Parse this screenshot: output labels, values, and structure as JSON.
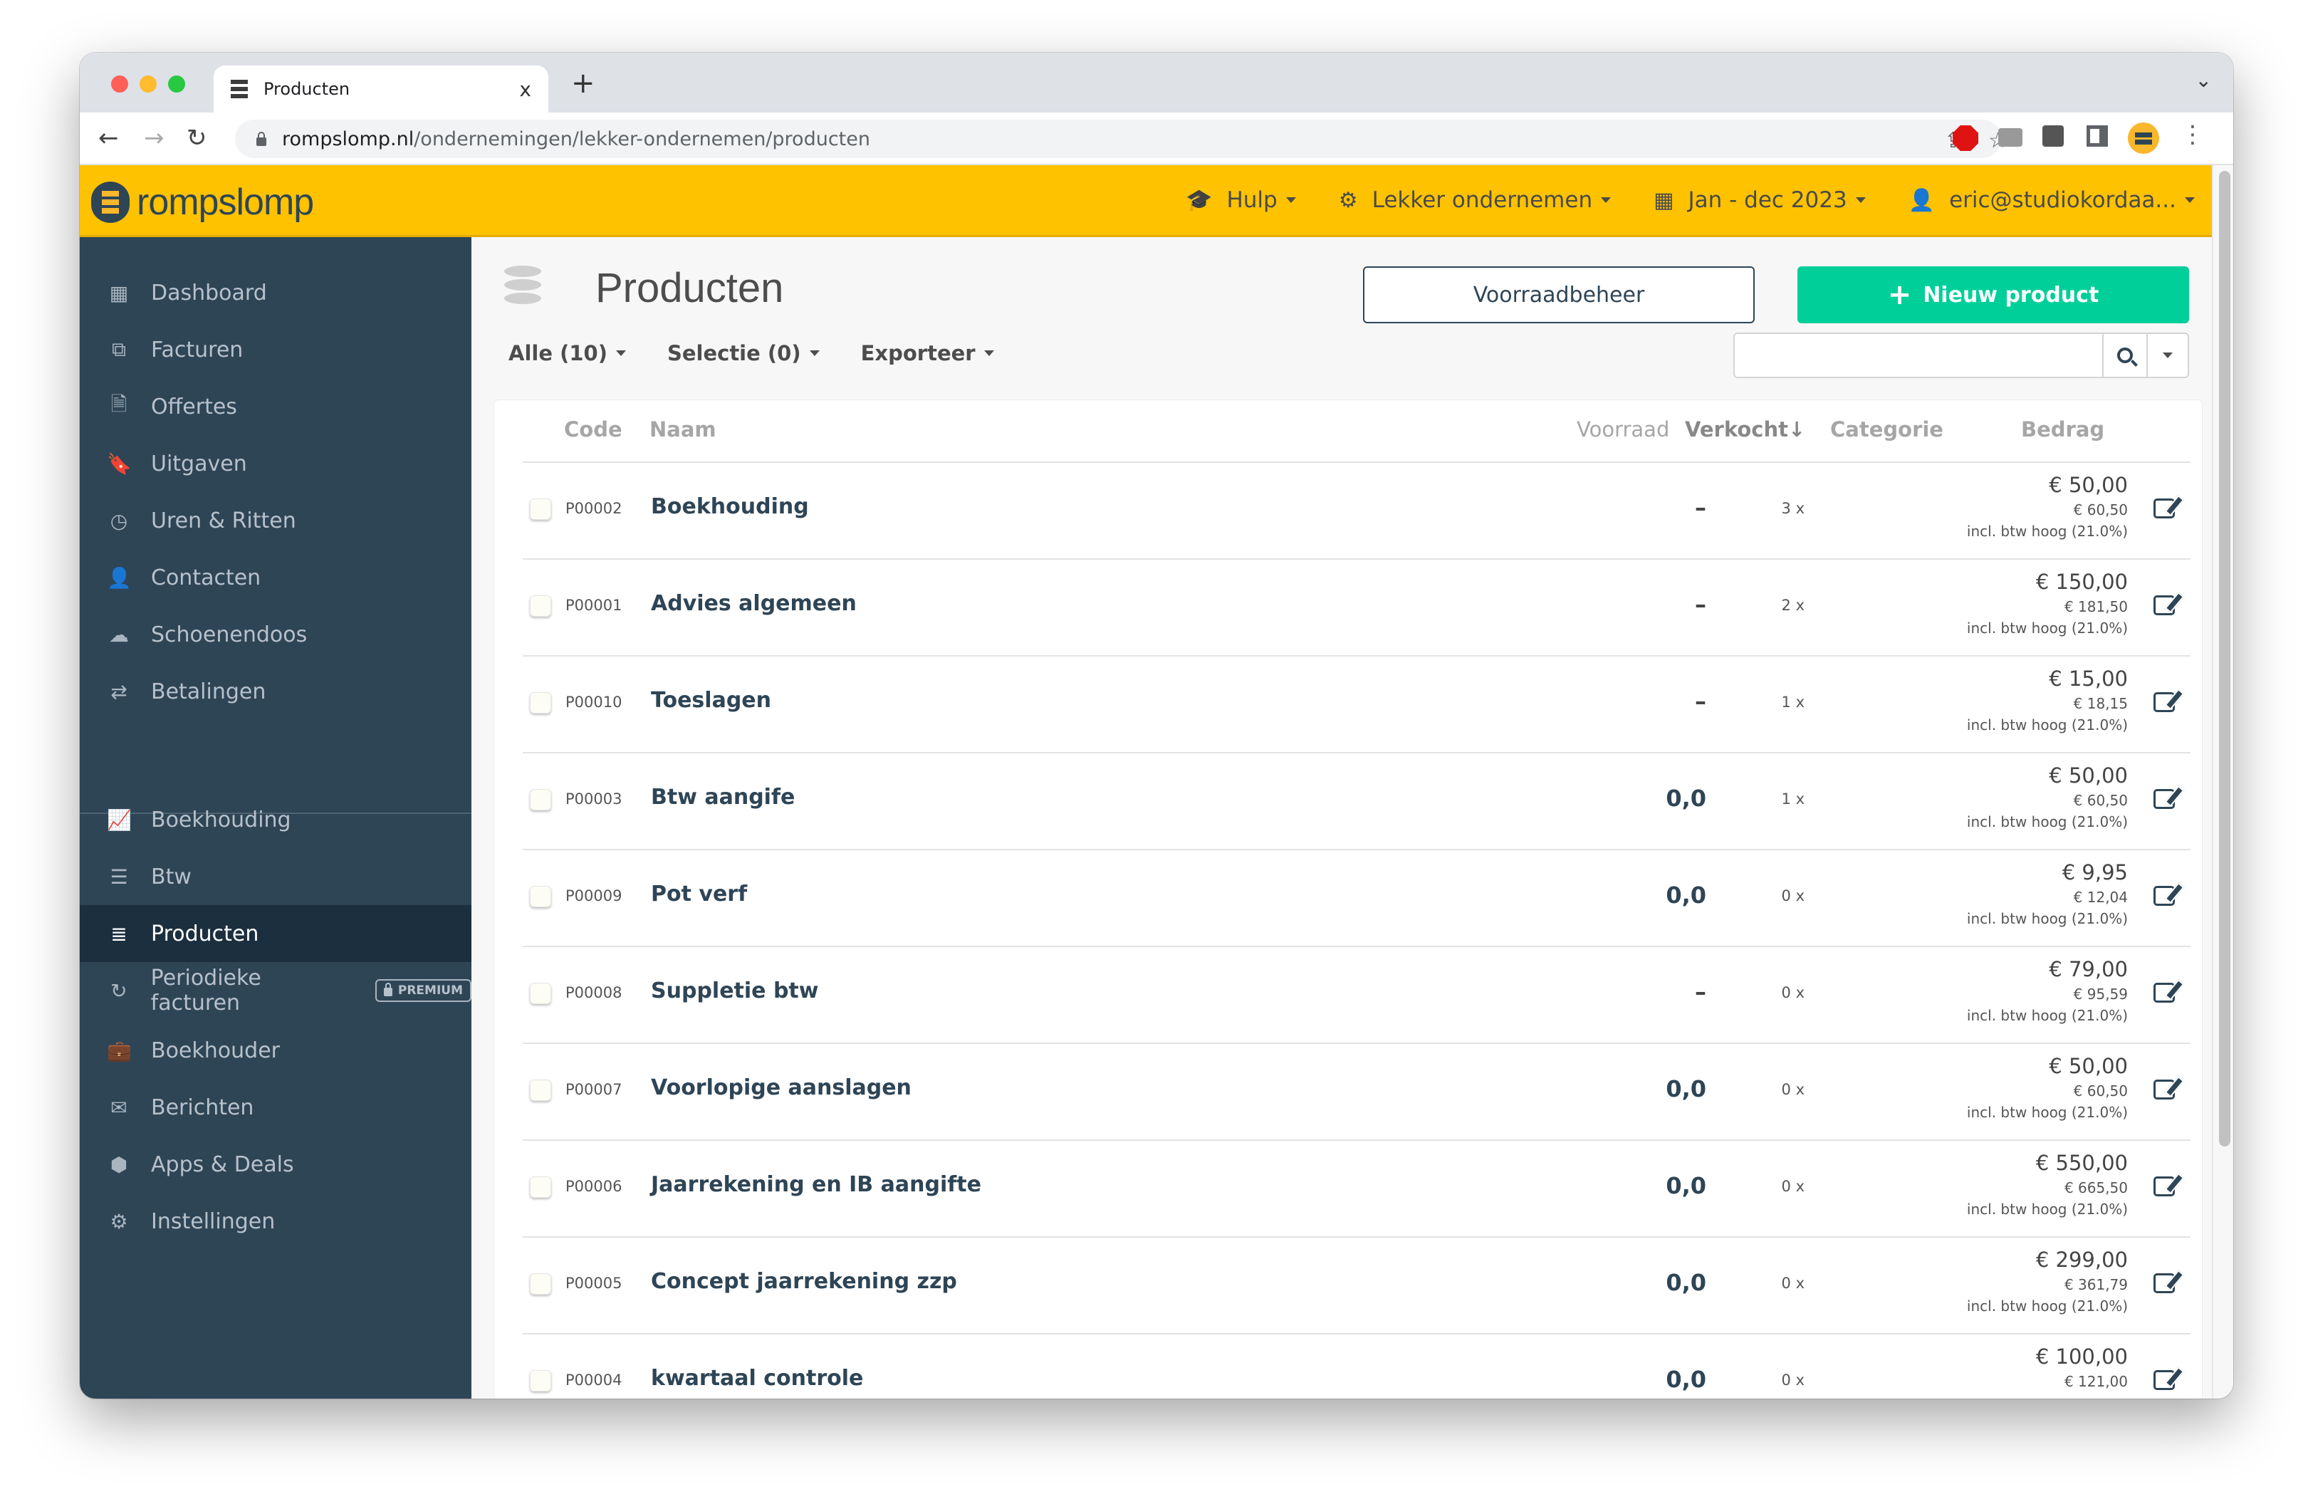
{
  "browser": {
    "tab_title": "Producten",
    "tab_close": "x",
    "new_tab": "+",
    "tab_menu": "⌄",
    "url_host": "rompslomp.nl",
    "url_path": "/ondernemingen/lekker-ondernemen/producten",
    "nav_back": "←",
    "nav_forward": "→",
    "nav_reload": "↻",
    "share_icon": "⇪",
    "bookmark_icon": "☆",
    "menu_icon": "⋮"
  },
  "app": {
    "logo_text": "rompslomp",
    "brand_color": "#ffc200",
    "sidebar_color": "#2e4556",
    "accent_color": "#01cf99",
    "topnav": [
      {
        "icon": "graduation-cap-icon",
        "glyph": "🎓",
        "label": "Hulp"
      },
      {
        "icon": "gear-icon",
        "glyph": "⚙",
        "label": "Lekker ondernemen"
      },
      {
        "icon": "calendar-icon",
        "glyph": "▦",
        "label": "Jan - dec 2023"
      },
      {
        "icon": "user-icon",
        "glyph": "👤",
        "label": "eric@studiokordaa..."
      }
    ]
  },
  "sidebar": {
    "items": [
      {
        "label": "Dashboard",
        "icon": "grid-icon",
        "glyph": "▦"
      },
      {
        "label": "Facturen",
        "icon": "copy-icon",
        "glyph": "⧉"
      },
      {
        "label": "Offertes",
        "icon": "file-text-icon",
        "glyph": "🗎"
      },
      {
        "label": "Uitgaven",
        "icon": "bookmark-icon",
        "glyph": "🔖"
      },
      {
        "label": "Uren & Ritten",
        "icon": "clock-icon",
        "glyph": "◷"
      },
      {
        "label": "Contacten",
        "icon": "user-icon",
        "glyph": "👤"
      },
      {
        "label": "Schoenendoos",
        "icon": "cloud-upload-icon",
        "glyph": "☁"
      },
      {
        "label": "Betalingen",
        "icon": "exchange-icon",
        "glyph": "⇄"
      },
      {
        "label": "Boekhouding",
        "icon": "line-chart-icon",
        "glyph": "📈"
      },
      {
        "label": "Btw",
        "icon": "server-icon",
        "glyph": "☰"
      },
      {
        "label": "Producten",
        "icon": "database-icon",
        "glyph": "≣",
        "active": true
      },
      {
        "label": "Periodieke facturen",
        "icon": "refresh-icon",
        "glyph": "↻",
        "badge": "PREMIUM"
      },
      {
        "label": "Boekhouder",
        "icon": "briefcase-icon",
        "glyph": "💼"
      },
      {
        "label": "Berichten",
        "icon": "envelope-icon",
        "glyph": "✉"
      },
      {
        "label": "Apps & Deals",
        "icon": "cubes-icon",
        "glyph": "⬢"
      },
      {
        "label": "Instellingen",
        "icon": "gear-icon",
        "glyph": "⚙"
      }
    ]
  },
  "page": {
    "title": "Producten",
    "stock_button": "Voorraadbeheer",
    "new_button": "Nieuw product",
    "new_button_icon": "+",
    "filters": [
      "Alle (10)",
      "Selectie (0)",
      "Exporteer"
    ],
    "search": {
      "value": "",
      "placeholder": ""
    }
  },
  "table": {
    "columns": {
      "code": "Code",
      "name": "Naam",
      "stock": "Voorraad",
      "sold": "Verkocht↓",
      "category": "Categorie",
      "amount": "Bedrag"
    },
    "rows": [
      {
        "code": "P00002",
        "name": "Boekhouding",
        "stock": "–",
        "sold": "3 x",
        "category": "",
        "amount": "€ 50,00",
        "incl": "€ 60,50",
        "vat": "incl. btw hoog (21.0%)"
      },
      {
        "code": "P00001",
        "name": "Advies algemeen",
        "stock": "–",
        "sold": "2 x",
        "category": "",
        "amount": "€ 150,00",
        "incl": "€ 181,50",
        "vat": "incl. btw hoog (21.0%)"
      },
      {
        "code": "P00010",
        "name": "Toeslagen",
        "stock": "–",
        "sold": "1 x",
        "category": "",
        "amount": "€ 15,00",
        "incl": "€ 18,15",
        "vat": "incl. btw hoog (21.0%)"
      },
      {
        "code": "P00003",
        "name": "Btw aangife",
        "stock": "0,0",
        "sold": "1 x",
        "category": "",
        "amount": "€ 50,00",
        "incl": "€ 60,50",
        "vat": "incl. btw hoog (21.0%)"
      },
      {
        "code": "P00009",
        "name": "Pot verf",
        "stock": "0,0",
        "sold": "0 x",
        "category": "",
        "amount": "€ 9,95",
        "incl": "€ 12,04",
        "vat": "incl. btw hoog (21.0%)"
      },
      {
        "code": "P00008",
        "name": "Suppletie btw",
        "stock": "–",
        "sold": "0 x",
        "category": "",
        "amount": "€ 79,00",
        "incl": "€ 95,59",
        "vat": "incl. btw hoog (21.0%)"
      },
      {
        "code": "P00007",
        "name": "Voorlopige aanslagen",
        "stock": "0,0",
        "sold": "0 x",
        "category": "",
        "amount": "€ 50,00",
        "incl": "€ 60,50",
        "vat": "incl. btw hoog (21.0%)"
      },
      {
        "code": "P00006",
        "name": "Jaarrekening en IB aangifte",
        "stock": "0,0",
        "sold": "0 x",
        "category": "",
        "amount": "€ 550,00",
        "incl": "€ 665,50",
        "vat": "incl. btw hoog (21.0%)"
      },
      {
        "code": "P00005",
        "name": "Concept jaarrekening zzp",
        "stock": "0,0",
        "sold": "0 x",
        "category": "",
        "amount": "€ 299,00",
        "incl": "€ 361,79",
        "vat": "incl. btw hoog (21.0%)"
      },
      {
        "code": "P00004",
        "name": "kwartaal controle",
        "stock": "0,0",
        "sold": "0 x",
        "category": "",
        "amount": "€ 100,00",
        "incl": "€ 121,00",
        "vat": ""
      }
    ]
  }
}
